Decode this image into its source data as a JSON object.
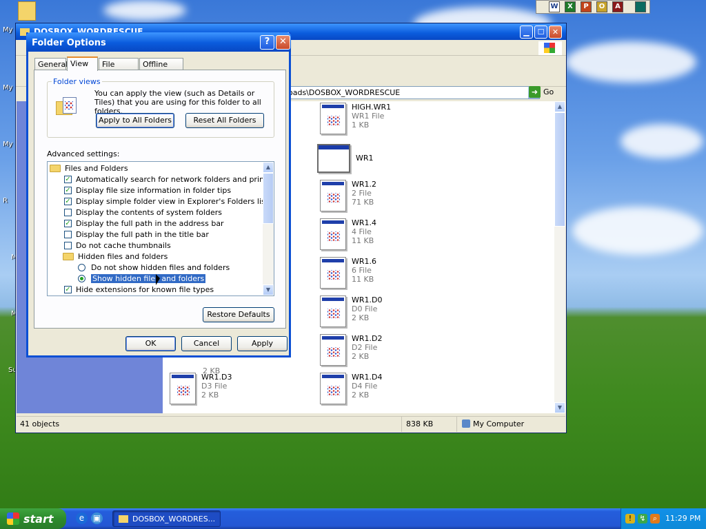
{
  "desktop": {
    "icons": [
      "My Documents",
      "My Computer",
      "My Network Places",
      "Recycle Bin",
      "Mozilla Firefox",
      "Microsoft Word",
      "SumatraPDF"
    ]
  },
  "office_bar": {
    "icons": [
      "word-icon",
      "excel-icon",
      "powerpoint-icon",
      "outlook-icon",
      "access-icon",
      "office-panel-icon"
    ]
  },
  "explorer": {
    "title": "DOSBOX_WORDRESCUE",
    "address_text": "oads\\DOSBOX_WORDRESCUE",
    "go_label": "Go",
    "files": [
      {
        "name": "HIGH.WR1",
        "type": "WR1 File",
        "size": "1 KB"
      },
      {
        "name": "WR1",
        "type": "",
        "size": ""
      },
      {
        "name": "WR1.2",
        "type": "2 File",
        "size": "71 KB"
      },
      {
        "name": "WR1.4",
        "type": "4 File",
        "size": "11 KB"
      },
      {
        "name": "WR1.6",
        "type": "6 File",
        "size": "11 KB"
      },
      {
        "name": "WR1.D0",
        "type": "D0 File",
        "size": "2 KB"
      },
      {
        "name": "WR1.D2",
        "type": "D2 File",
        "size": "2 KB"
      },
      {
        "name": "WR1.D4",
        "type": "D4 File",
        "size": "2 KB"
      },
      {
        "name": "WR1.D3",
        "type": "D3 File",
        "size": "2 KB"
      },
      {
        "name": "",
        "type": "",
        "size": "2 KB"
      }
    ],
    "status": {
      "objects": "41 objects",
      "size": "838 KB",
      "zone": "My Computer"
    }
  },
  "dialog": {
    "title": "Folder Options",
    "tabs": [
      "General",
      "View",
      "File Types",
      "Offline Files"
    ],
    "active_tab": "View",
    "folder_views": {
      "label": "Folder views",
      "description": "You can apply the view (such as Details or Tiles) that you are using for this folder to all folders.",
      "apply_all": "Apply to All Folders",
      "reset_all": "Reset All Folders"
    },
    "advanced_label": "Advanced settings:",
    "settings": [
      {
        "kind": "folder",
        "label": "Files and Folders"
      },
      {
        "kind": "check",
        "checked": true,
        "label": "Automatically search for network folders and printers"
      },
      {
        "kind": "check",
        "checked": true,
        "label": "Display file size information in folder tips"
      },
      {
        "kind": "check",
        "checked": true,
        "label": "Display simple folder view in Explorer's Folders list"
      },
      {
        "kind": "check",
        "checked": false,
        "label": "Display the contents of system folders"
      },
      {
        "kind": "check",
        "checked": true,
        "label": "Display the full path in the address bar"
      },
      {
        "kind": "check",
        "checked": false,
        "label": "Display the full path in the title bar"
      },
      {
        "kind": "check",
        "checked": false,
        "label": "Do not cache thumbnails"
      },
      {
        "kind": "folder",
        "label": "Hidden files and folders"
      },
      {
        "kind": "radio",
        "checked": false,
        "label": "Do not show hidden files and folders"
      },
      {
        "kind": "radio",
        "checked": true,
        "label": "Show hidden files and folders",
        "selected": true
      },
      {
        "kind": "check",
        "checked": true,
        "label": "Hide extensions for known file types"
      }
    ],
    "restore_defaults": "Restore Defaults",
    "ok": "OK",
    "cancel": "Cancel",
    "apply": "Apply"
  },
  "taskbar": {
    "start_label": "start",
    "task_label": "DOSBOX_WORDRES...",
    "clock": "11:29 PM"
  },
  "colors": {
    "title_blue": "#0a5bdc",
    "selection": "#316ac5",
    "check_green": "#21a121"
  }
}
